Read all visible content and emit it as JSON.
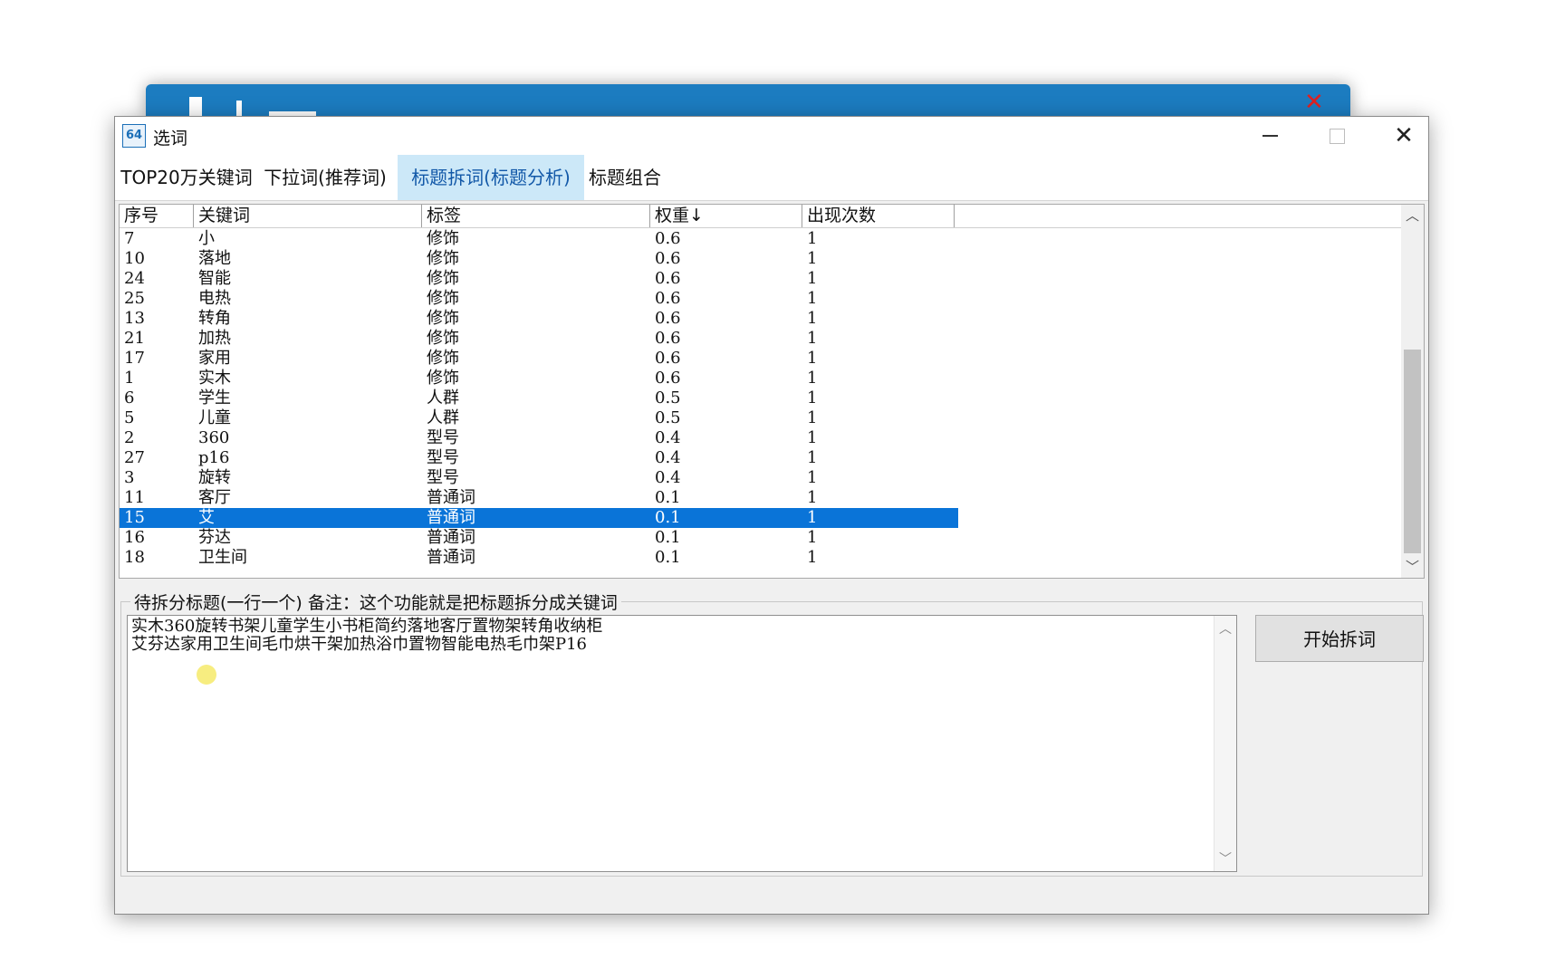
{
  "window": {
    "icon_text": "64",
    "title": "选词"
  },
  "tabs": [
    {
      "label": "TOP20万关键词",
      "active": false
    },
    {
      "label": "下拉词(推荐词)",
      "active": false
    },
    {
      "label": "标题拆词(标题分析)",
      "active": true
    },
    {
      "label": "标题组合",
      "active": false
    }
  ],
  "table": {
    "headers": [
      "序号",
      "关键词",
      "标签",
      "权重↓",
      "出现次数"
    ],
    "rows": [
      [
        "7",
        "小",
        "修饰",
        "0.6",
        "1"
      ],
      [
        "10",
        "落地",
        "修饰",
        "0.6",
        "1"
      ],
      [
        "24",
        "智能",
        "修饰",
        "0.6",
        "1"
      ],
      [
        "25",
        "电热",
        "修饰",
        "0.6",
        "1"
      ],
      [
        "13",
        "转角",
        "修饰",
        "0.6",
        "1"
      ],
      [
        "21",
        "加热",
        "修饰",
        "0.6",
        "1"
      ],
      [
        "17",
        "家用",
        "修饰",
        "0.6",
        "1"
      ],
      [
        "1",
        "实木",
        "修饰",
        "0.6",
        "1"
      ],
      [
        "6",
        "学生",
        "人群",
        "0.5",
        "1"
      ],
      [
        "5",
        "儿童",
        "人群",
        "0.5",
        "1"
      ],
      [
        "2",
        "360",
        "型号",
        "0.4",
        "1"
      ],
      [
        "27",
        "p16",
        "型号",
        "0.4",
        "1"
      ],
      [
        "3",
        "旋转",
        "型号",
        "0.4",
        "1"
      ],
      [
        "11",
        "客厅",
        "普通词",
        "0.1",
        "1"
      ],
      [
        "15",
        "艾",
        "普通词",
        "0.1",
        "1"
      ],
      [
        "16",
        "芬达",
        "普通词",
        "0.1",
        "1"
      ],
      [
        "18",
        "卫生间",
        "普通词",
        "0.1",
        "1"
      ]
    ],
    "selected_row": 14,
    "selection_color": "#0a74d8"
  },
  "split_panel": {
    "legend": "待拆分标题(一行一个)  备注：这个功能就是把标题拆分成关键词",
    "lines": [
      "实木360旋转书架儿童学生小书柜简约落地客厅置物架转角收纳柜",
      "艾芬达家用卫生间毛巾烘干架加热浴巾置物智能电热毛巾架P16"
    ],
    "button_label": "开始拆词"
  },
  "colors": {
    "accent": "#0a74d8",
    "active_tab_bg": "#cce8f8",
    "background_window": "#1c7cc0"
  }
}
